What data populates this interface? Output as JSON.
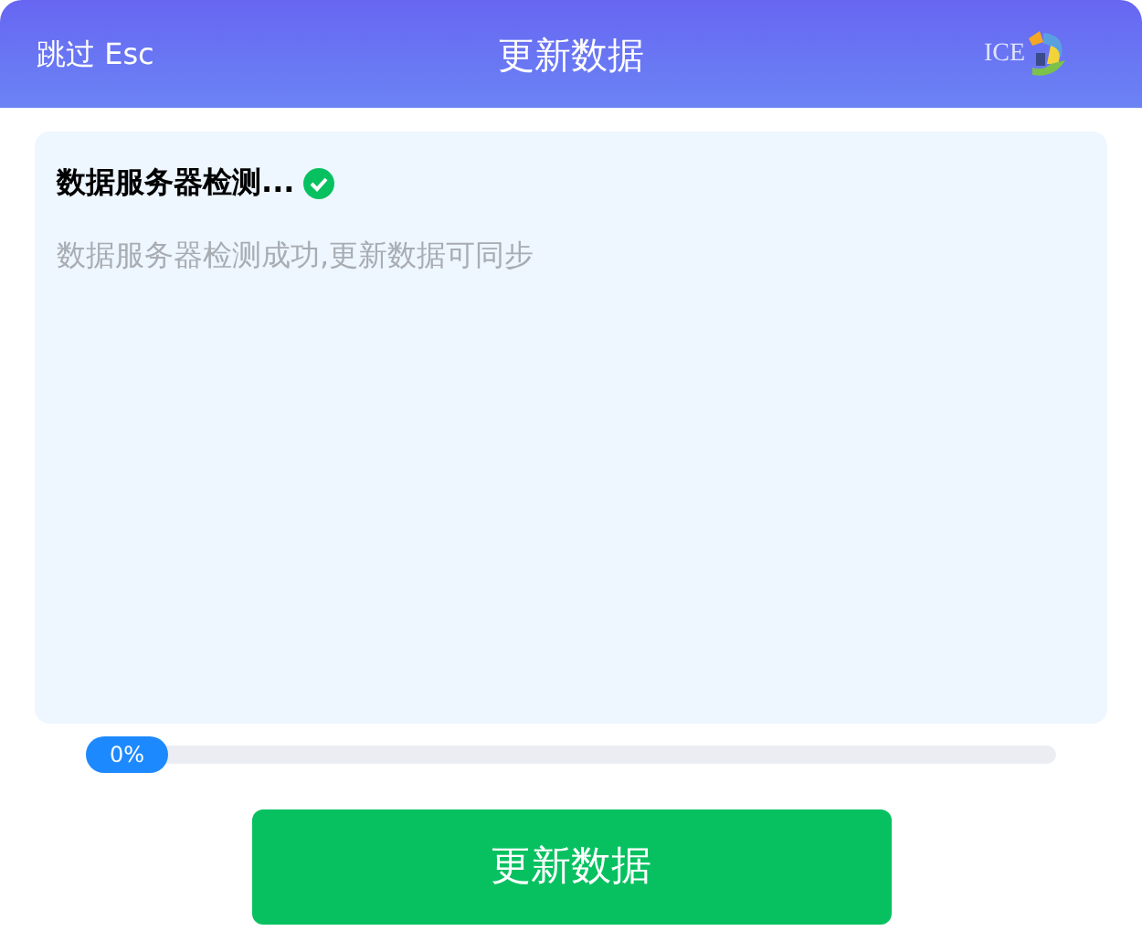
{
  "header": {
    "skip_label": "跳过 Esc",
    "title": "更新数据",
    "logo_text": "ICE"
  },
  "status": {
    "title": "数据服务器检测...",
    "done": true,
    "message": "数据服务器检测成功,更新数据可同步"
  },
  "progress": {
    "reading": "0%"
  },
  "action_button": "更新数据"
}
